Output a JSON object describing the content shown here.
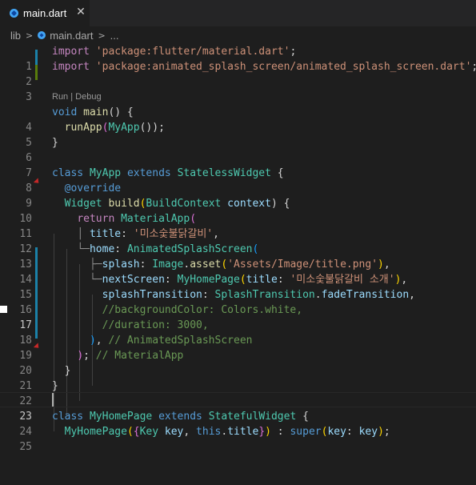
{
  "tab": {
    "filename": "main.dart",
    "close_glyph": "✕",
    "icon": "dart-file-icon"
  },
  "breadcrumb": {
    "folder": "lib",
    "file": "main.dart",
    "more": "..."
  },
  "codelens": {
    "text": "Run | Debug"
  },
  "line_numbers": [
    "1",
    "2",
    "3",
    "4",
    "5",
    "6",
    "7",
    "8",
    "9",
    "10",
    "11",
    "12",
    "13",
    "14",
    "15",
    "16",
    "17",
    "18",
    "19",
    "20",
    "21",
    "22",
    "23",
    "24",
    "25"
  ],
  "code": {
    "l1_kw": "import",
    "l1_str": "'package:flutter/material.dart'",
    "l1_end": ";",
    "l2_kw": "import",
    "l2_str": "'package:animated_splash_screen/animated_splash_screen.dart'",
    "l2_end": ";",
    "l4_type": "void",
    "l4_fn": "main",
    "l4_rest": "() {",
    "l5_fn": "runApp",
    "l5_cls": "MyApp",
    "l5_end": "());",
    "l6": "}",
    "l8_kw": "class",
    "l8_cls": "MyApp",
    "l8_kw2": "extends",
    "l8_base": "StatelessWidget",
    "l8_end": " {",
    "l9": "@override",
    "l10_type": "Widget",
    "l10_fn": "build",
    "l10_ptype": "BuildContext",
    "l10_param": "context",
    "l10_end": ") {",
    "l11_kw": "return",
    "l11_cls": "MaterialApp",
    "l12_prop": "title",
    "l12_str": "'미소숯불닭갈비'",
    "l13_prop": "home",
    "l13_cls": "AnimatedSplashScreen",
    "l14_prop": "splash",
    "l14_cls": "Image",
    "l14_fn": "asset",
    "l14_str": "'Assets/Image/title.png'",
    "l15_prop": "nextScreen",
    "l15_cls": "MyHomePage",
    "l15_prop2": "title",
    "l15_str": "'미소숯불닭갈비 소개'",
    "l16_prop": "splashTransition",
    "l16_cls": "SplashTransition",
    "l16_val": "fadeTransition",
    "l17": "//backgroundColor: Colors.white,",
    "l18": "//duration: 3000,",
    "l19_cm": "// AnimatedSplashScreen",
    "l20_cm": "// MaterialApp",
    "l21": "}",
    "l22": "}",
    "l24_kw": "class",
    "l24_cls": "MyHomePage",
    "l24_kw2": "extends",
    "l24_base": "StatefulWidget",
    "l24_end": " {",
    "l25_cls": "MyHomePage",
    "l25_type": "Key",
    "l25_param": "key",
    "l25_this": "this",
    "l25_title": "title",
    "l25_super": "super",
    "l25_key": "key",
    "l25_val": "key"
  },
  "colors": {
    "background": "#1e1e1e",
    "keyword": "#569cd6",
    "class": "#4ec9b0",
    "string": "#ce9178",
    "function": "#dcdcaa",
    "variable": "#9cdcfe",
    "comment": "#6a9955",
    "modified_gutter": "#1b81a8",
    "added_gutter": "#587c0c"
  }
}
